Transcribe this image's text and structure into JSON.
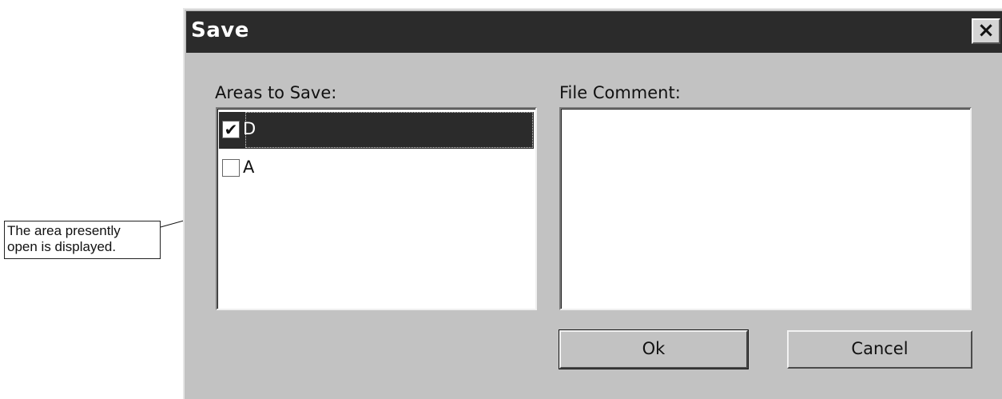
{
  "dialog": {
    "title": "Save",
    "close_label": "×",
    "areas_label": "Areas to Save:",
    "comment_label": "File Comment:",
    "areas": [
      {
        "label": "D",
        "checked": true,
        "selected": true
      },
      {
        "label": "A",
        "checked": false,
        "selected": false
      }
    ],
    "comment_value": "",
    "ok_label": "Ok",
    "cancel_label": "Cancel"
  },
  "callout": {
    "line1": "The area presently",
    "line2": "open is displayed."
  }
}
